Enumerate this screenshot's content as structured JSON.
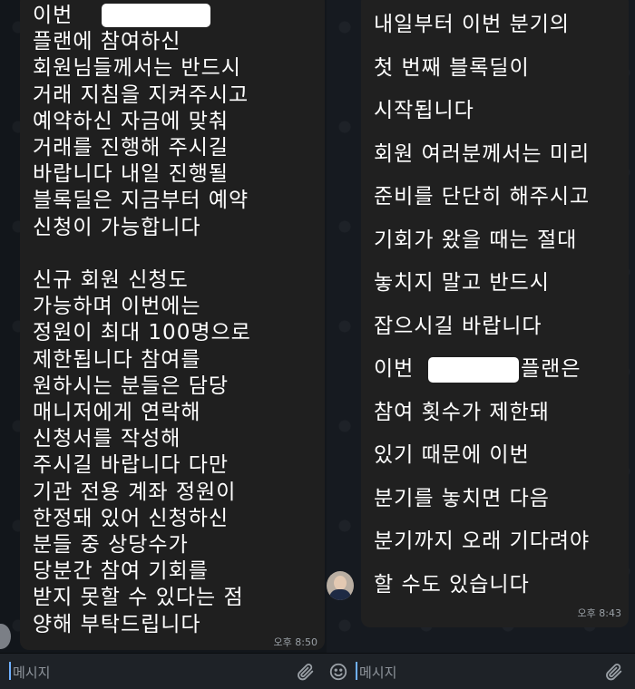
{
  "left_chat": {
    "message_lines": [
      "이번",
      "플랜에 참여하신",
      "회원님들께서는 반드시",
      "거래 지침을 지켜주시고",
      "예약하신 자금에 맞춰",
      "거래를 진행해 주시길",
      "바랍니다 내일 진행될",
      "블록딜은 지금부터 예약",
      "신청이 가능합니다",
      "",
      "신규 회원 신청도",
      "가능하며 이번에는",
      "정원이 최대 100명으로",
      "제한됩니다 참여를",
      "원하시는 분들은 담당",
      "매니저에게 연락해",
      "신청서를 작성해",
      "주시길 바랍니다 다만",
      "기관 전용 계좌 정원이",
      "한정돼 있어 신청하신",
      "분들 중 상당수가",
      "당분간 참여 기회를",
      "받지 못할 수 있다는 점",
      "양해 부탁드립니다"
    ],
    "time": "오후 8:50",
    "input_placeholder": "메시지"
  },
  "right_chat": {
    "message_lines": [
      "내일부터 이번 분기의",
      "첫 번째 블록딜이",
      "시작됩니다",
      "회원 여러분께서는 미리",
      "준비를 단단히 해주시고",
      "기회가 왔을 때는 절대",
      "놓치지 말고 반드시",
      "잡으시길 바랍니다",
      "이번",
      "참여 횟수가 제한돼",
      "있기 때문에 이번",
      "분기를 놓치면 다음",
      "분기까지 오래 기다려야",
      "할 수도 있습니다"
    ],
    "redacted_line_suffix": "플랜은",
    "time": "오후 8:43",
    "input_placeholder": "메시지"
  },
  "icons": {
    "attach": "paperclip-icon",
    "emoji": "emoji-icon"
  }
}
